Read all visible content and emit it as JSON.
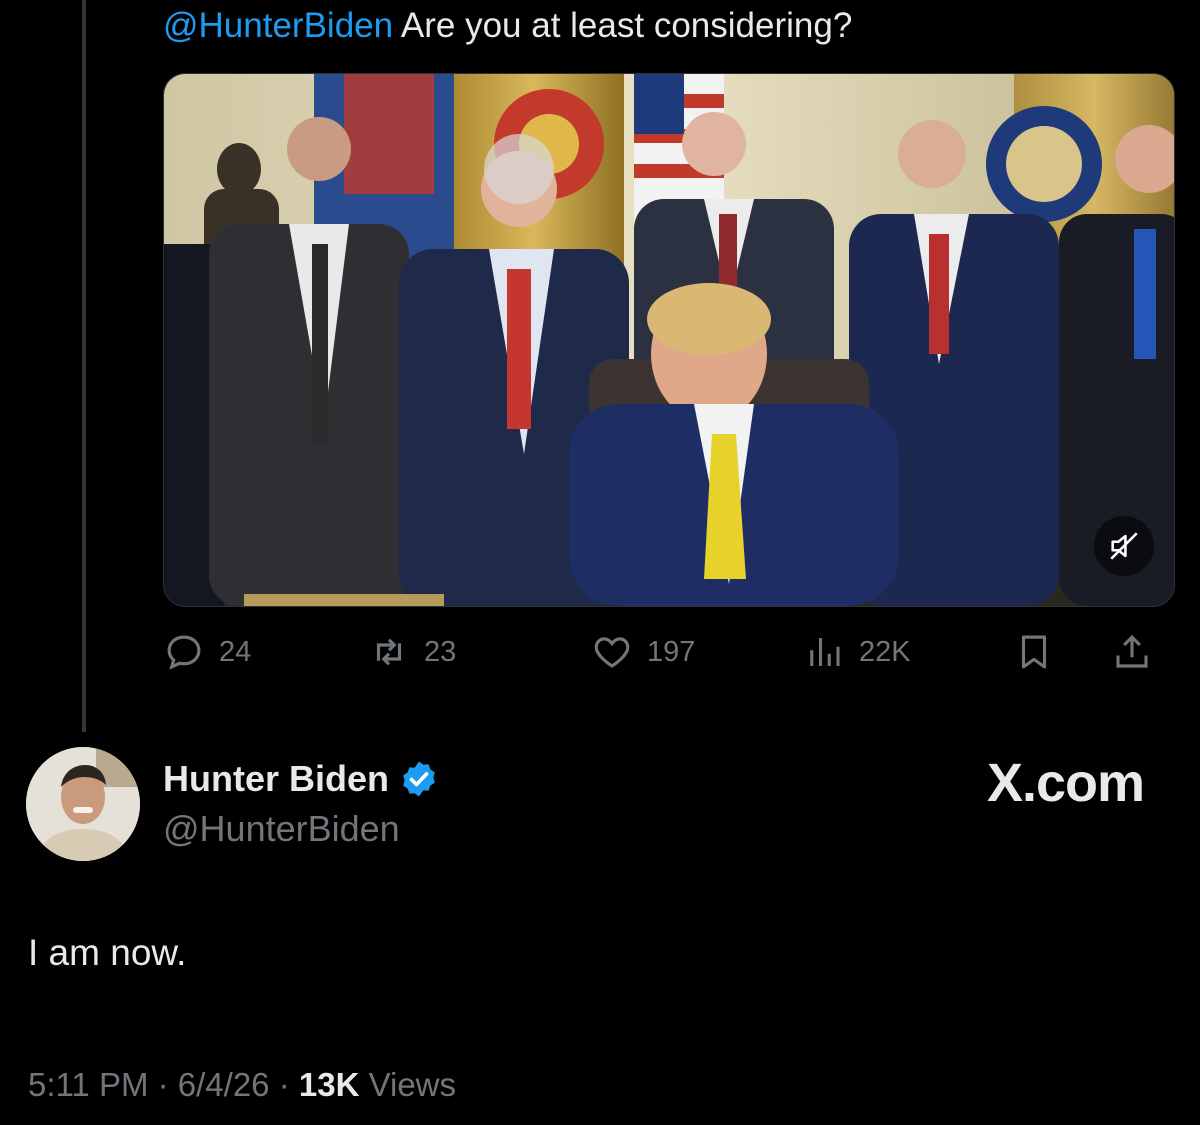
{
  "reply": {
    "mention": "@HunterBiden",
    "text": " Are you at least considering?"
  },
  "media": {
    "description_icon": "muted-speaker-icon"
  },
  "actions": {
    "replies": "24",
    "reposts": "23",
    "likes": "197",
    "views": "22K"
  },
  "tweet": {
    "display_name": "Hunter Biden",
    "handle": "@HunterBiden",
    "text": "I am now.",
    "time": "5:11 PM",
    "date": "6/4/26",
    "views_count": "13K",
    "views_label": " Views",
    "sep": " · "
  },
  "brand": "X.com",
  "colors": {
    "accent": "#1d9bf0",
    "muted": "#71767b",
    "text": "#e7e9ea",
    "background": "#000000"
  }
}
